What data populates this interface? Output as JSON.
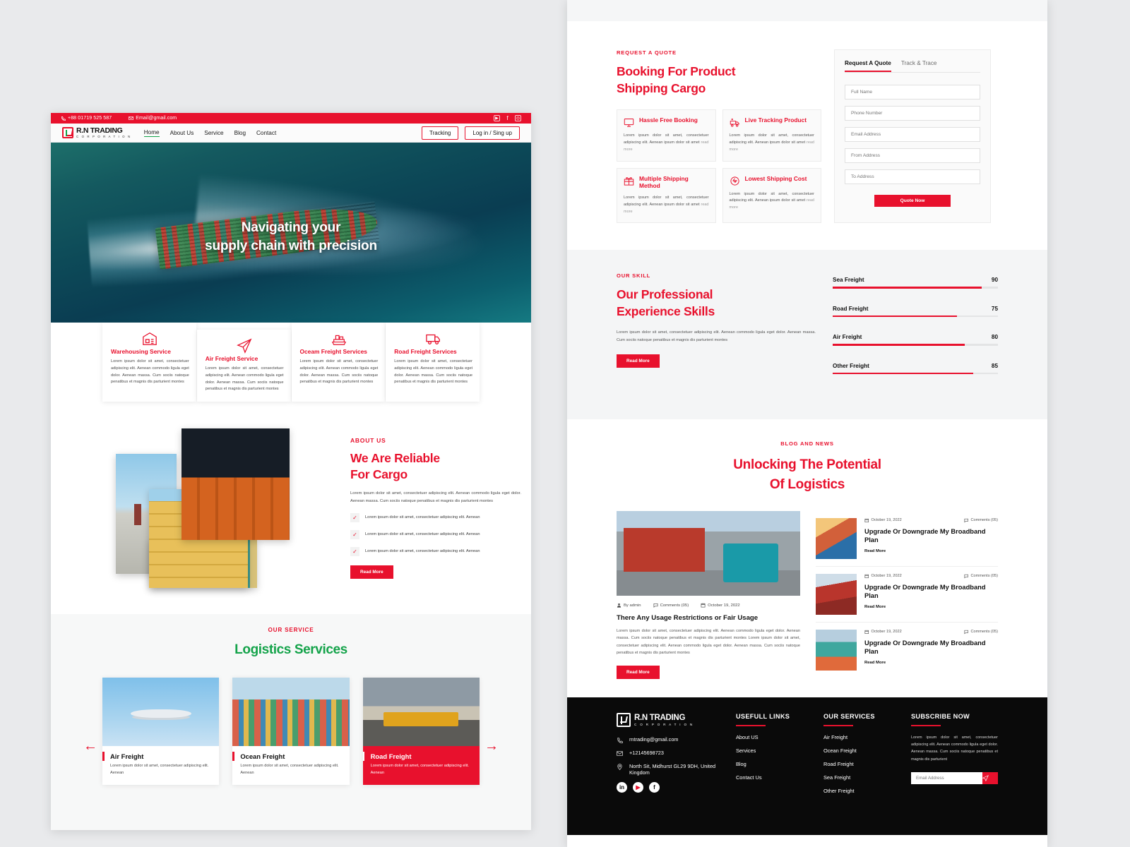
{
  "brand": {
    "name": "R.N TRADING",
    "sub": "C O R P O R A T I O N"
  },
  "topbar": {
    "phone": "+88 01719 525 587",
    "email": "Email@gmail.com",
    "socials": [
      "youtube-icon",
      "facebook-icon",
      "instagram-icon"
    ]
  },
  "nav": {
    "links": [
      {
        "label": "Home",
        "active": true
      },
      {
        "label": "About Us",
        "active": false
      },
      {
        "label": "Service",
        "active": false
      },
      {
        "label": "Blog",
        "active": false
      },
      {
        "label": "Contact",
        "active": false
      }
    ],
    "tracking_label": "Tracking",
    "login_label": "Log in / Sing up"
  },
  "hero": {
    "title_line1": "Navigating your",
    "title_line2": "supply chain with precision"
  },
  "service_strip": [
    {
      "icon": "warehouse-icon",
      "title": "Warehousing Service",
      "body": "Lorem ipsum dolor sit amet, consectetuer adipiscing elit. Aenean commodo ligula eget dolor. Aenean massa. Cum sociis natoque penatibus et magnis dis parturient montes"
    },
    {
      "icon": "paper-plane-icon",
      "title": "Air Freight Service",
      "body": "Lorem ipsum dolor sit amet, consectetuer adipiscing elit. Aenean commodo ligula eget dolor. Aenean massa. Cum sociis natoque penatibus et magnis dis parturient montes"
    },
    {
      "icon": "cargo-ship-icon",
      "title": "Oceam Freight Services",
      "body": "Lorem ipsum dolor sit amet, consectetuer adipiscing elit. Aenean commodo ligula eget dolor. Aenean massa. Cum sociis natoque penatibus et magnis dis parturient montes"
    },
    {
      "icon": "truck-icon",
      "title": "Road Freight Services",
      "body": "Lorem ipsum dolor sit amet, consectetuer adipiscing elit. Aenean commodo ligula eget dolor. Aenean massa. Cum sociis natoque penatibus et magnis dis parturient montes"
    }
  ],
  "about": {
    "eyebrow": "ABOUT US",
    "heading_line1": "We Are Reliable",
    "heading_line2": "For Cargo",
    "paragraph": "Lorem ipsum dolor sit amet, consectetuer adipiscing elit. Aenean commodo ligula eget dolor. Aenean massa. Cum sociis natoque penatibus et magnis dis parturient montes",
    "checks": [
      "Lorem ipsum dolor sit amet, consectetuer adipiscing elit. Aenean",
      "Lorem ipsum dolor sit amet, consectetuer adipiscing elit. Aenean",
      "Lorem ipsum dolor sit amet, consectetuer adipiscing elit. Aenean"
    ],
    "read_more": "Read More"
  },
  "our_service": {
    "eyebrow": "OUR SERVICE",
    "heading": "Logistics Services",
    "heading_color": "#14a34a",
    "cards": [
      {
        "title": "Air Freight",
        "text": "Lorem ipsum dolor sit amet, consectetuer adipiscing elit. Aenean",
        "featured": false,
        "image": "airplane-image"
      },
      {
        "title": "Ocean Freight",
        "text": "Lorem ipsum dolor sit amet, consectetuer adipiscing elit. Aenean",
        "featured": false,
        "image": "container-port-image"
      },
      {
        "title": "Road Freight",
        "text": "Lorem ipsum dolor sit amet, consectetuer adipiscing elit. Aenean",
        "featured": true,
        "image": "truck-highway-image"
      }
    ],
    "prev": "←",
    "next": "→"
  },
  "quote": {
    "eyebrow": "REQUEST A QUOTE",
    "heading_line1": "Booking For Product",
    "heading_line2": "Shipping Cargo",
    "features": [
      {
        "icon": "monitor-icon",
        "title": "Hassle Free Booking",
        "text": "Lorem ipsum dolor sit amet, consectetuer adipiscing elit. Aenean ipsum dolor sit amet ",
        "read_more": "read more"
      },
      {
        "icon": "tracking-icon",
        "title": "Live Tracking Product",
        "text": "Lorem ipsum dolor sit amet, consectetuer adipiscing elit. Aenean ipsum dolor sit amet ",
        "read_more": "read more"
      },
      {
        "icon": "gift-icon",
        "title": "Multiple Shipping Method",
        "text": "Lorem ipsum dolor sit amet, consectetuer adipiscing elit. Aenean ipsum dolor sit amet ",
        "read_more": "read more"
      },
      {
        "icon": "lowest-cost-icon",
        "title": "Lowest Shipping Cost",
        "text": "Lorem ipsum dolor sit amet, consectetuer adipiscing elit. Aenean ipsum dolor sit amet ",
        "read_more": "read more"
      }
    ],
    "form": {
      "tab_quote": "Request A Quote",
      "tab_track": "Track & Trace",
      "fields": [
        {
          "name": "full-name",
          "placeholder": "Full Name",
          "value": ""
        },
        {
          "name": "phone-number",
          "placeholder": "Phone Number",
          "value": ""
        },
        {
          "name": "email-address",
          "placeholder": "Email Address",
          "value": ""
        },
        {
          "name": "from-address",
          "placeholder": "From Address",
          "value": ""
        },
        {
          "name": "to-address",
          "placeholder": "To Address",
          "value": ""
        }
      ],
      "submit_label": "Quote Now"
    }
  },
  "skills": {
    "eyebrow": "OUR SKILL",
    "heading_line1": "Our Professional",
    "heading_line2": "Experience Skills",
    "paragraph": "Lorem ipsum dolor sit amet, consectetuer adipiscing elit. Aenean commodo ligula eget dolor. Aenean massa. Cum sociis natoque penatibus et magnis dis parturient montes",
    "read_more": "Read More"
  },
  "chart_data": {
    "type": "bar",
    "title": "Our Professional Experience Skills",
    "orientation": "horizontal",
    "categories": [
      "Sea Freight",
      "Road Freight",
      "Air Freight",
      "Other Freight"
    ],
    "values": [
      90,
      75,
      80,
      85
    ],
    "xlabel": "",
    "ylabel": "",
    "xlim": [
      0,
      100
    ],
    "grid": false,
    "legend": "none",
    "bar_color": "#e8112d",
    "track_color": "#e3e4e5",
    "value_labels": [
      "90",
      "75",
      "80",
      "85"
    ]
  },
  "blog": {
    "eyebrow": "BLOG AND NEWS",
    "heading_line1": "Unlocking The Potential",
    "heading_line2": "Of Logistics",
    "main": {
      "image": "forklift-warehouse-image",
      "author": "By admin",
      "comments": "Comments (05)",
      "date": "October 19, 2022",
      "title": "There Any Usage Restrictions or Fair Usage",
      "text": "Lorem ipsum dolor sit amet, consectetuer adipiscing elit. Aenean commodo ligula eget dolor. Aenean massa. Cum sociis natoque penatibus et magnis dis parturient montes Lorem ipsum dolor sit amet, consectetuer adipiscing elit. Aenean commodo ligula eget dolor. Aenean massa. Cum sociis natoque penatibus et magnis dis parturient montes",
      "read_more": "Read More"
    },
    "side": [
      {
        "date": "October 19, 2022",
        "comments": "Comments (05)",
        "title": "Upgrade Or Downgrade My Broadband Plan",
        "read_more": "Read More",
        "image": "container-street-image"
      },
      {
        "date": "October 19, 2022",
        "comments": "Comments (05)",
        "title": "Upgrade Or Downgrade My Broadband Plan",
        "read_more": "Read More",
        "image": "red-ship-image"
      },
      {
        "date": "October 19, 2022",
        "comments": "Comments (05)",
        "title": "Upgrade Or Downgrade My Broadband Plan",
        "read_more": "Read More",
        "image": "crane-container-image"
      }
    ]
  },
  "footer": {
    "email": "rntrading@gmail.com",
    "phone": "+12145698723",
    "address": "North Sit, Midhurst GL29 9DH, United Kingdom",
    "socials": [
      "linkedin-icon",
      "youtube-icon",
      "facebook-icon"
    ],
    "useful": {
      "heading": "USEFULL LINKS",
      "links": [
        "About US",
        "Services",
        "Blog",
        "Contact Us"
      ]
    },
    "services": {
      "heading": "OUR SERVICES",
      "links": [
        "Air Freight",
        "Ocean Freight",
        "Road Freight",
        "Sea Freight",
        "Other Freight"
      ]
    },
    "subscribe": {
      "heading": "SUBSCRIBE NOW",
      "text": "Lorem ipsum dolor sit amet, consectetuer adipiscing elit. Aenean commodo ligula eget dolor. Aenean massa. Cum sociis natoque penatibus et magnis dis parturient",
      "placeholder": "Email Address",
      "button": "send-icon"
    }
  },
  "colors": {
    "brand_red": "#e8112d",
    "brand_green": "#14a34a",
    "footer_bg": "#0a0a0a"
  }
}
